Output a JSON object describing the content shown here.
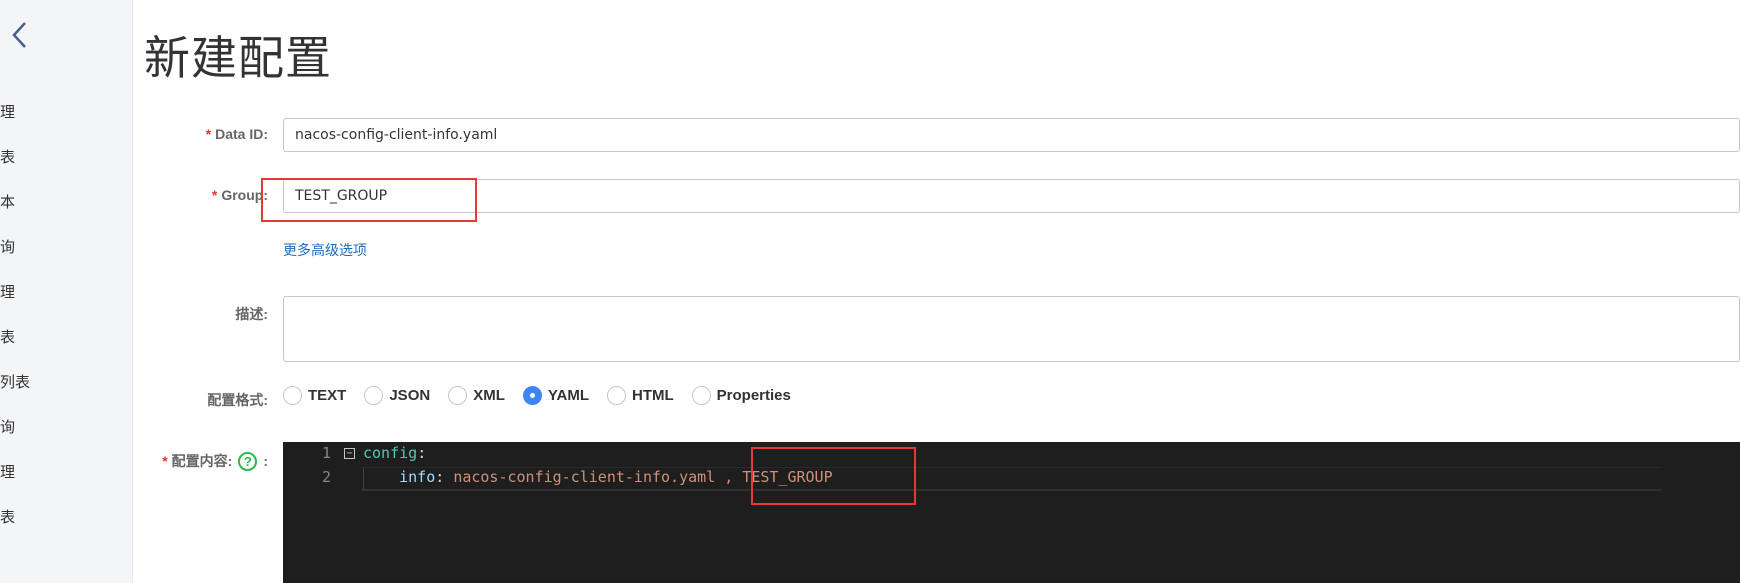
{
  "page": {
    "title": "新建配置"
  },
  "sidebar": {
    "items": [
      "理",
      "表",
      "本",
      "询",
      "理",
      "表",
      "列表",
      "询",
      "理",
      "表"
    ]
  },
  "form": {
    "data_id": {
      "label": "Data ID:",
      "required": "*",
      "value": "nacos-config-client-info.yaml"
    },
    "group": {
      "label": "Group:",
      "required": "*",
      "value": "TEST_GROUP"
    },
    "advanced_link": "更多高级选项",
    "description": {
      "label": "描述:",
      "value": ""
    },
    "format": {
      "label": "配置格式:",
      "options": [
        "TEXT",
        "JSON",
        "XML",
        "YAML",
        "HTML",
        "Properties"
      ],
      "selected": "YAML"
    },
    "content": {
      "label": "配置内容:",
      "required": "*",
      "help": "?",
      "colon": ":"
    }
  },
  "editor": {
    "lines": [
      {
        "num": "1",
        "key": "config",
        "colon": ":",
        "value": ""
      },
      {
        "num": "2",
        "key": "info",
        "colon": ":",
        "value": "nacos-config-client-info.yaml , TEST_GROUP"
      }
    ],
    "fold_icon": "minus-box-icon"
  },
  "colors": {
    "required": "#e5392b",
    "link": "#1b6ec2",
    "radio_checked": "#3e86f5",
    "highlight_box": "#e53935",
    "editor_bg": "#1e1e1e"
  }
}
